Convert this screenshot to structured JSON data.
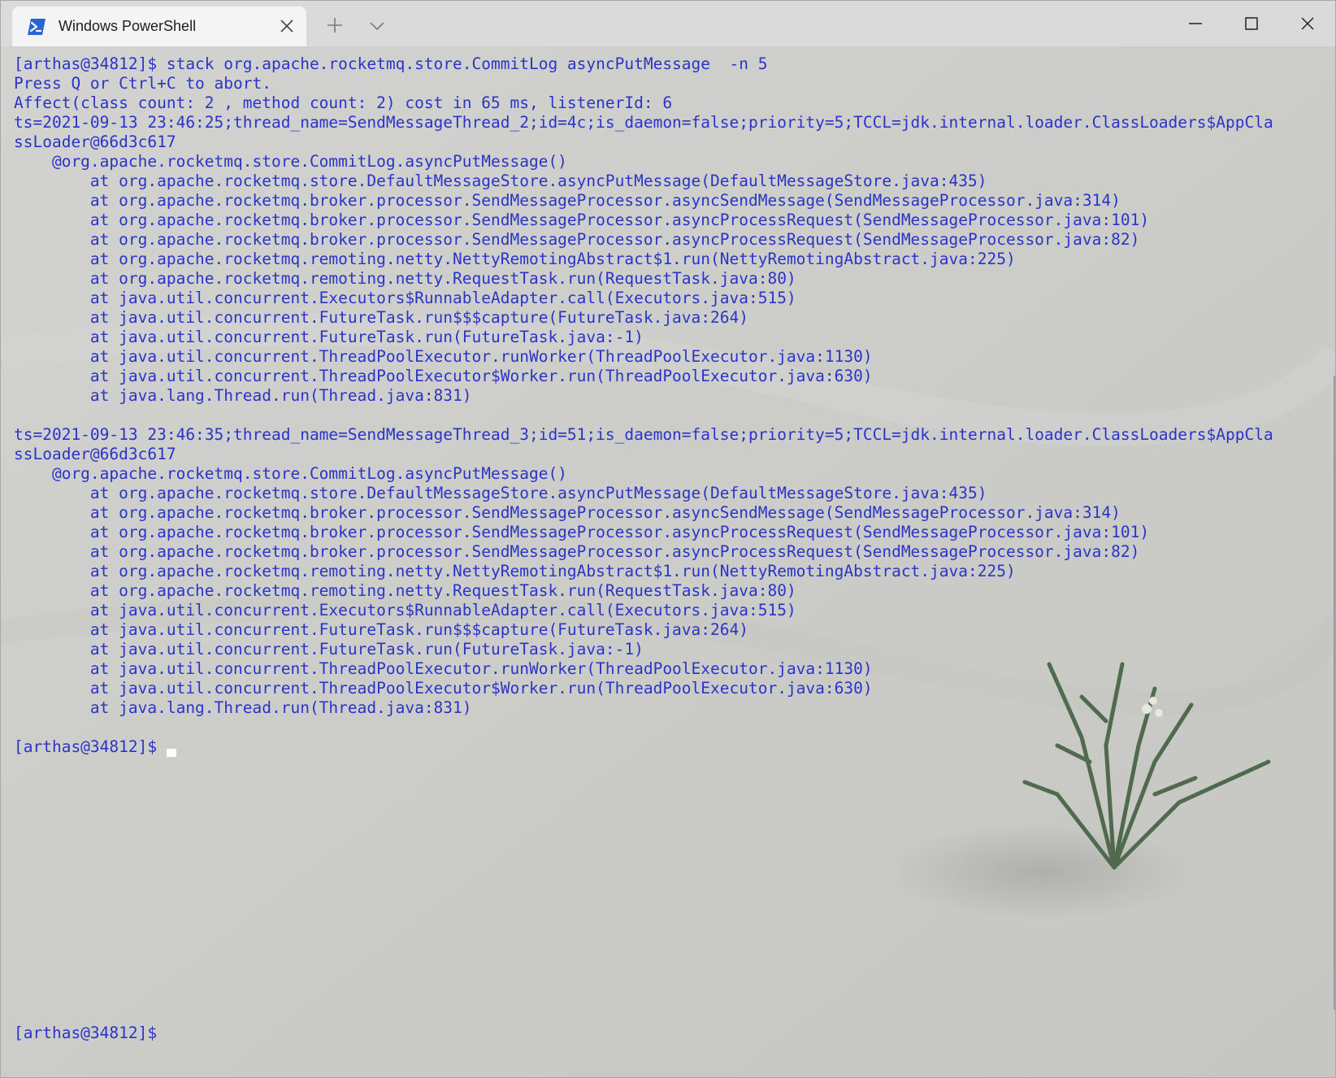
{
  "window": {
    "tab_title": "Windows PowerShell",
    "accent_color": "#2a35c8"
  },
  "icons": {
    "tab": "powershell-icon",
    "close_tab": "close-icon",
    "new_tab": "plus-icon",
    "dropdown": "chevron-down-icon",
    "minimize": "minimize-icon",
    "maximize": "maximize-icon",
    "close_window": "close-icon"
  },
  "terminal": {
    "lines": [
      "[arthas@34812]$ stack org.apache.rocketmq.store.CommitLog asyncPutMessage  -n 5",
      "Press Q or Ctrl+C to abort.",
      "Affect(class count: 2 , method count: 2) cost in 65 ms, listenerId: 6",
      "ts=2021-09-13 23:46:25;thread_name=SendMessageThread_2;id=4c;is_daemon=false;priority=5;TCCL=jdk.internal.loader.ClassLoaders$AppCla",
      "ssLoader@66d3c617",
      "    @org.apache.rocketmq.store.CommitLog.asyncPutMessage()",
      "        at org.apache.rocketmq.store.DefaultMessageStore.asyncPutMessage(DefaultMessageStore.java:435)",
      "        at org.apache.rocketmq.broker.processor.SendMessageProcessor.asyncSendMessage(SendMessageProcessor.java:314)",
      "        at org.apache.rocketmq.broker.processor.SendMessageProcessor.asyncProcessRequest(SendMessageProcessor.java:101)",
      "        at org.apache.rocketmq.broker.processor.SendMessageProcessor.asyncProcessRequest(SendMessageProcessor.java:82)",
      "        at org.apache.rocketmq.remoting.netty.NettyRemotingAbstract$1.run(NettyRemotingAbstract.java:225)",
      "        at org.apache.rocketmq.remoting.netty.RequestTask.run(RequestTask.java:80)",
      "        at java.util.concurrent.Executors$RunnableAdapter.call(Executors.java:515)",
      "        at java.util.concurrent.FutureTask.run$$$capture(FutureTask.java:264)",
      "        at java.util.concurrent.FutureTask.run(FutureTask.java:-1)",
      "        at java.util.concurrent.ThreadPoolExecutor.runWorker(ThreadPoolExecutor.java:1130)",
      "        at java.util.concurrent.ThreadPoolExecutor$Worker.run(ThreadPoolExecutor.java:630)",
      "        at java.lang.Thread.run(Thread.java:831)",
      "",
      "ts=2021-09-13 23:46:35;thread_name=SendMessageThread_3;id=51;is_daemon=false;priority=5;TCCL=jdk.internal.loader.ClassLoaders$AppCla",
      "ssLoader@66d3c617",
      "    @org.apache.rocketmq.store.CommitLog.asyncPutMessage()",
      "        at org.apache.rocketmq.store.DefaultMessageStore.asyncPutMessage(DefaultMessageStore.java:435)",
      "        at org.apache.rocketmq.broker.processor.SendMessageProcessor.asyncSendMessage(SendMessageProcessor.java:314)",
      "        at org.apache.rocketmq.broker.processor.SendMessageProcessor.asyncProcessRequest(SendMessageProcessor.java:101)",
      "        at org.apache.rocketmq.broker.processor.SendMessageProcessor.asyncProcessRequest(SendMessageProcessor.java:82)",
      "        at org.apache.rocketmq.remoting.netty.NettyRemotingAbstract$1.run(NettyRemotingAbstract.java:225)",
      "        at org.apache.rocketmq.remoting.netty.RequestTask.run(RequestTask.java:80)",
      "        at java.util.concurrent.Executors$RunnableAdapter.call(Executors.java:515)",
      "        at java.util.concurrent.FutureTask.run$$$capture(FutureTask.java:264)",
      "        at java.util.concurrent.FutureTask.run(FutureTask.java:-1)",
      "        at java.util.concurrent.ThreadPoolExecutor.runWorker(ThreadPoolExecutor.java:1130)",
      "        at java.util.concurrent.ThreadPoolExecutor$Worker.run(ThreadPoolExecutor.java:630)",
      "        at java.lang.Thread.run(Thread.java:831)",
      ""
    ],
    "active_prompt": "[arthas@34812]$",
    "bottom_prompt": "[arthas@34812]$"
  }
}
